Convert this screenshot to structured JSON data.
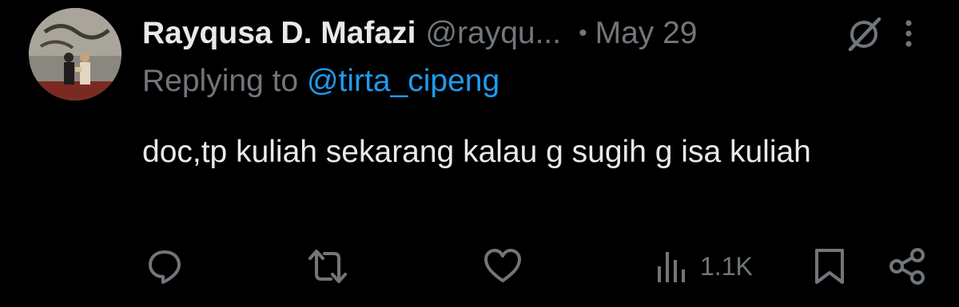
{
  "tweet": {
    "author": {
      "display_name": "Rayqusa D. Mafazi",
      "handle": "@rayqu...",
      "avatar_icon": "profile-photo"
    },
    "separator": "•",
    "date": "May 29",
    "reply": {
      "label": "Replying to",
      "mention": "@tirta_cipeng"
    },
    "text": "doc,tp kuliah sekarang kalau g sugih g isa kuliah",
    "actions": {
      "reply_icon": "speech-bubble-icon",
      "retweet_icon": "retweet-arrows-icon",
      "like_icon": "heart-icon",
      "views_icon": "bar-chart-icon",
      "views_count": "1.1K",
      "bookmark_icon": "bookmark-icon",
      "share_icon": "share-nodes-icon"
    },
    "header_icons": {
      "grok": "grok-icon",
      "more": "more-vertical-icon"
    }
  },
  "colors": {
    "background": "#000000",
    "primary_text": "#e7e9ea",
    "secondary_text": "#71767b",
    "link": "#1d9bf0"
  }
}
